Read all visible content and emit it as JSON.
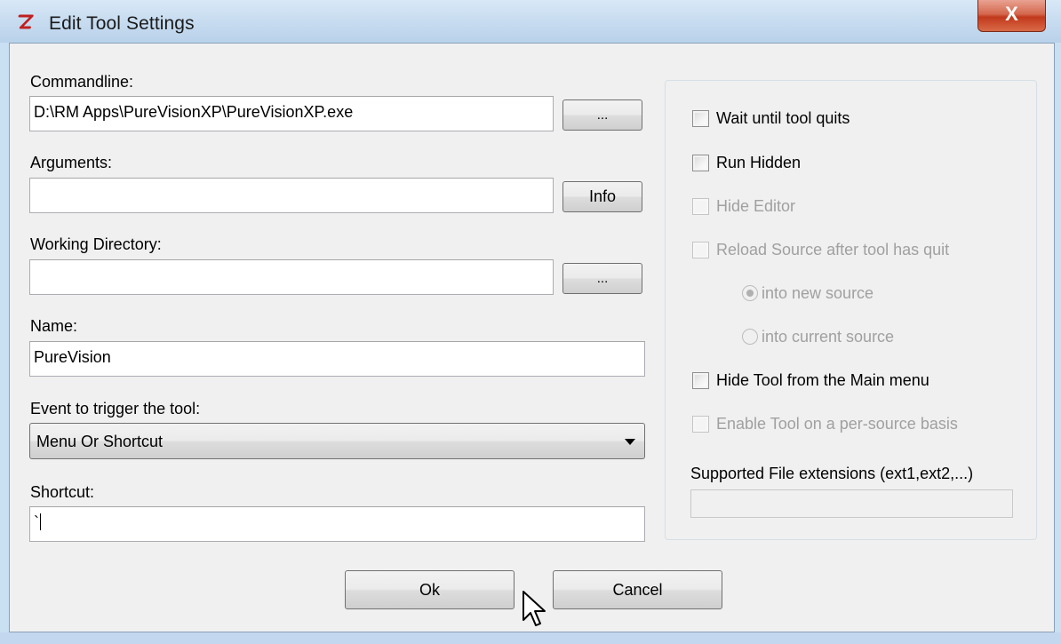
{
  "window": {
    "title": "Edit Tool Settings",
    "close_glyph": "X",
    "icon": "z-app-icon"
  },
  "form": {
    "commandline_label": "Commandline:",
    "commandline_value": "D:\\RM Apps\\PureVisionXP\\PureVisionXP.exe",
    "commandline_browse": "...",
    "arguments_label": "Arguments:",
    "arguments_value": "",
    "arguments_info": "Info",
    "workdir_label": "Working Directory:",
    "workdir_value": "",
    "workdir_browse": "...",
    "name_label": "Name:",
    "name_value": "PureVision",
    "event_label": "Event to trigger the tool:",
    "event_value": "Menu Or Shortcut",
    "shortcut_label": "Shortcut:",
    "shortcut_value": "`"
  },
  "options": {
    "wait_until_quits": "Wait until tool quits",
    "run_hidden": "Run Hidden",
    "hide_editor": "Hide Editor",
    "reload_source": "Reload Source after tool has quit",
    "into_new_source": "into new source",
    "into_current_source": "into current source",
    "hide_from_main_menu": "Hide Tool from the Main menu",
    "enable_per_source": "Enable Tool on a per-source basis",
    "supported_ext_label": "Supported File extensions (ext1,ext2,...)",
    "supported_ext_value": ""
  },
  "buttons": {
    "ok": "Ok",
    "cancel": "Cancel"
  },
  "colors": {
    "frame": "#c9dff2",
    "client": "#f0f0f0",
    "disabled_text": "#a0a0a0",
    "close_button": "#c2391c"
  }
}
